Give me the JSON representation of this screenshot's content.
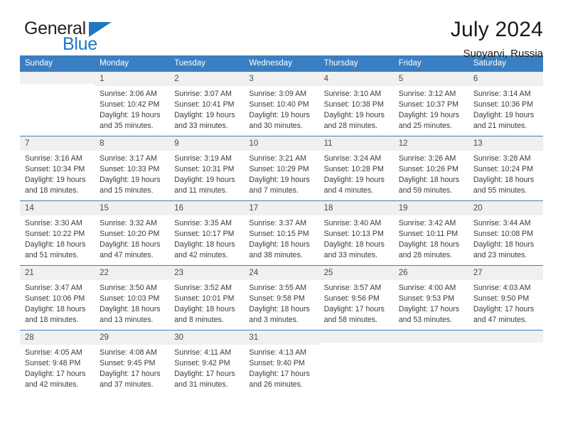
{
  "brand": {
    "name_part1": "General",
    "name_part2": "Blue",
    "triangle_icon": "triangle-icon",
    "color_primary": "#1f77c4",
    "color_text": "#222222"
  },
  "header": {
    "title": "July 2024",
    "subtitle": "Suoyarvi, Russia"
  },
  "calendar": {
    "header_bg": "#3a7fc1",
    "daynum_bg": "#f0f0f0",
    "weekday_headers": [
      "Sunday",
      "Monday",
      "Tuesday",
      "Wednesday",
      "Thursday",
      "Friday",
      "Saturday"
    ],
    "weeks": [
      [
        {
          "day": "",
          "sunrise": "",
          "sunset": "",
          "daylight_line1": "",
          "daylight_line2": ""
        },
        {
          "day": "1",
          "sunrise": "Sunrise: 3:06 AM",
          "sunset": "Sunset: 10:42 PM",
          "daylight_line1": "Daylight: 19 hours",
          "daylight_line2": "and 35 minutes."
        },
        {
          "day": "2",
          "sunrise": "Sunrise: 3:07 AM",
          "sunset": "Sunset: 10:41 PM",
          "daylight_line1": "Daylight: 19 hours",
          "daylight_line2": "and 33 minutes."
        },
        {
          "day": "3",
          "sunrise": "Sunrise: 3:09 AM",
          "sunset": "Sunset: 10:40 PM",
          "daylight_line1": "Daylight: 19 hours",
          "daylight_line2": "and 30 minutes."
        },
        {
          "day": "4",
          "sunrise": "Sunrise: 3:10 AM",
          "sunset": "Sunset: 10:38 PM",
          "daylight_line1": "Daylight: 19 hours",
          "daylight_line2": "and 28 minutes."
        },
        {
          "day": "5",
          "sunrise": "Sunrise: 3:12 AM",
          "sunset": "Sunset: 10:37 PM",
          "daylight_line1": "Daylight: 19 hours",
          "daylight_line2": "and 25 minutes."
        },
        {
          "day": "6",
          "sunrise": "Sunrise: 3:14 AM",
          "sunset": "Sunset: 10:36 PM",
          "daylight_line1": "Daylight: 19 hours",
          "daylight_line2": "and 21 minutes."
        }
      ],
      [
        {
          "day": "7",
          "sunrise": "Sunrise: 3:16 AM",
          "sunset": "Sunset: 10:34 PM",
          "daylight_line1": "Daylight: 19 hours",
          "daylight_line2": "and 18 minutes."
        },
        {
          "day": "8",
          "sunrise": "Sunrise: 3:17 AM",
          "sunset": "Sunset: 10:33 PM",
          "daylight_line1": "Daylight: 19 hours",
          "daylight_line2": "and 15 minutes."
        },
        {
          "day": "9",
          "sunrise": "Sunrise: 3:19 AM",
          "sunset": "Sunset: 10:31 PM",
          "daylight_line1": "Daylight: 19 hours",
          "daylight_line2": "and 11 minutes."
        },
        {
          "day": "10",
          "sunrise": "Sunrise: 3:21 AM",
          "sunset": "Sunset: 10:29 PM",
          "daylight_line1": "Daylight: 19 hours",
          "daylight_line2": "and 7 minutes."
        },
        {
          "day": "11",
          "sunrise": "Sunrise: 3:24 AM",
          "sunset": "Sunset: 10:28 PM",
          "daylight_line1": "Daylight: 19 hours",
          "daylight_line2": "and 4 minutes."
        },
        {
          "day": "12",
          "sunrise": "Sunrise: 3:26 AM",
          "sunset": "Sunset: 10:26 PM",
          "daylight_line1": "Daylight: 18 hours",
          "daylight_line2": "and 59 minutes."
        },
        {
          "day": "13",
          "sunrise": "Sunrise: 3:28 AM",
          "sunset": "Sunset: 10:24 PM",
          "daylight_line1": "Daylight: 18 hours",
          "daylight_line2": "and 55 minutes."
        }
      ],
      [
        {
          "day": "14",
          "sunrise": "Sunrise: 3:30 AM",
          "sunset": "Sunset: 10:22 PM",
          "daylight_line1": "Daylight: 18 hours",
          "daylight_line2": "and 51 minutes."
        },
        {
          "day": "15",
          "sunrise": "Sunrise: 3:32 AM",
          "sunset": "Sunset: 10:20 PM",
          "daylight_line1": "Daylight: 18 hours",
          "daylight_line2": "and 47 minutes."
        },
        {
          "day": "16",
          "sunrise": "Sunrise: 3:35 AM",
          "sunset": "Sunset: 10:17 PM",
          "daylight_line1": "Daylight: 18 hours",
          "daylight_line2": "and 42 minutes."
        },
        {
          "day": "17",
          "sunrise": "Sunrise: 3:37 AM",
          "sunset": "Sunset: 10:15 PM",
          "daylight_line1": "Daylight: 18 hours",
          "daylight_line2": "and 38 minutes."
        },
        {
          "day": "18",
          "sunrise": "Sunrise: 3:40 AM",
          "sunset": "Sunset: 10:13 PM",
          "daylight_line1": "Daylight: 18 hours",
          "daylight_line2": "and 33 minutes."
        },
        {
          "day": "19",
          "sunrise": "Sunrise: 3:42 AM",
          "sunset": "Sunset: 10:11 PM",
          "daylight_line1": "Daylight: 18 hours",
          "daylight_line2": "and 28 minutes."
        },
        {
          "day": "20",
          "sunrise": "Sunrise: 3:44 AM",
          "sunset": "Sunset: 10:08 PM",
          "daylight_line1": "Daylight: 18 hours",
          "daylight_line2": "and 23 minutes."
        }
      ],
      [
        {
          "day": "21",
          "sunrise": "Sunrise: 3:47 AM",
          "sunset": "Sunset: 10:06 PM",
          "daylight_line1": "Daylight: 18 hours",
          "daylight_line2": "and 18 minutes."
        },
        {
          "day": "22",
          "sunrise": "Sunrise: 3:50 AM",
          "sunset": "Sunset: 10:03 PM",
          "daylight_line1": "Daylight: 18 hours",
          "daylight_line2": "and 13 minutes."
        },
        {
          "day": "23",
          "sunrise": "Sunrise: 3:52 AM",
          "sunset": "Sunset: 10:01 PM",
          "daylight_line1": "Daylight: 18 hours",
          "daylight_line2": "and 8 minutes."
        },
        {
          "day": "24",
          "sunrise": "Sunrise: 3:55 AM",
          "sunset": "Sunset: 9:58 PM",
          "daylight_line1": "Daylight: 18 hours",
          "daylight_line2": "and 3 minutes."
        },
        {
          "day": "25",
          "sunrise": "Sunrise: 3:57 AM",
          "sunset": "Sunset: 9:56 PM",
          "daylight_line1": "Daylight: 17 hours",
          "daylight_line2": "and 58 minutes."
        },
        {
          "day": "26",
          "sunrise": "Sunrise: 4:00 AM",
          "sunset": "Sunset: 9:53 PM",
          "daylight_line1": "Daylight: 17 hours",
          "daylight_line2": "and 53 minutes."
        },
        {
          "day": "27",
          "sunrise": "Sunrise: 4:03 AM",
          "sunset": "Sunset: 9:50 PM",
          "daylight_line1": "Daylight: 17 hours",
          "daylight_line2": "and 47 minutes."
        }
      ],
      [
        {
          "day": "28",
          "sunrise": "Sunrise: 4:05 AM",
          "sunset": "Sunset: 9:48 PM",
          "daylight_line1": "Daylight: 17 hours",
          "daylight_line2": "and 42 minutes."
        },
        {
          "day": "29",
          "sunrise": "Sunrise: 4:08 AM",
          "sunset": "Sunset: 9:45 PM",
          "daylight_line1": "Daylight: 17 hours",
          "daylight_line2": "and 37 minutes."
        },
        {
          "day": "30",
          "sunrise": "Sunrise: 4:11 AM",
          "sunset": "Sunset: 9:42 PM",
          "daylight_line1": "Daylight: 17 hours",
          "daylight_line2": "and 31 minutes."
        },
        {
          "day": "31",
          "sunrise": "Sunrise: 4:13 AM",
          "sunset": "Sunset: 9:40 PM",
          "daylight_line1": "Daylight: 17 hours",
          "daylight_line2": "and 26 minutes."
        },
        {
          "day": "",
          "sunrise": "",
          "sunset": "",
          "daylight_line1": "",
          "daylight_line2": ""
        },
        {
          "day": "",
          "sunrise": "",
          "sunset": "",
          "daylight_line1": "",
          "daylight_line2": ""
        },
        {
          "day": "",
          "sunrise": "",
          "sunset": "",
          "daylight_line1": "",
          "daylight_line2": ""
        }
      ]
    ]
  }
}
